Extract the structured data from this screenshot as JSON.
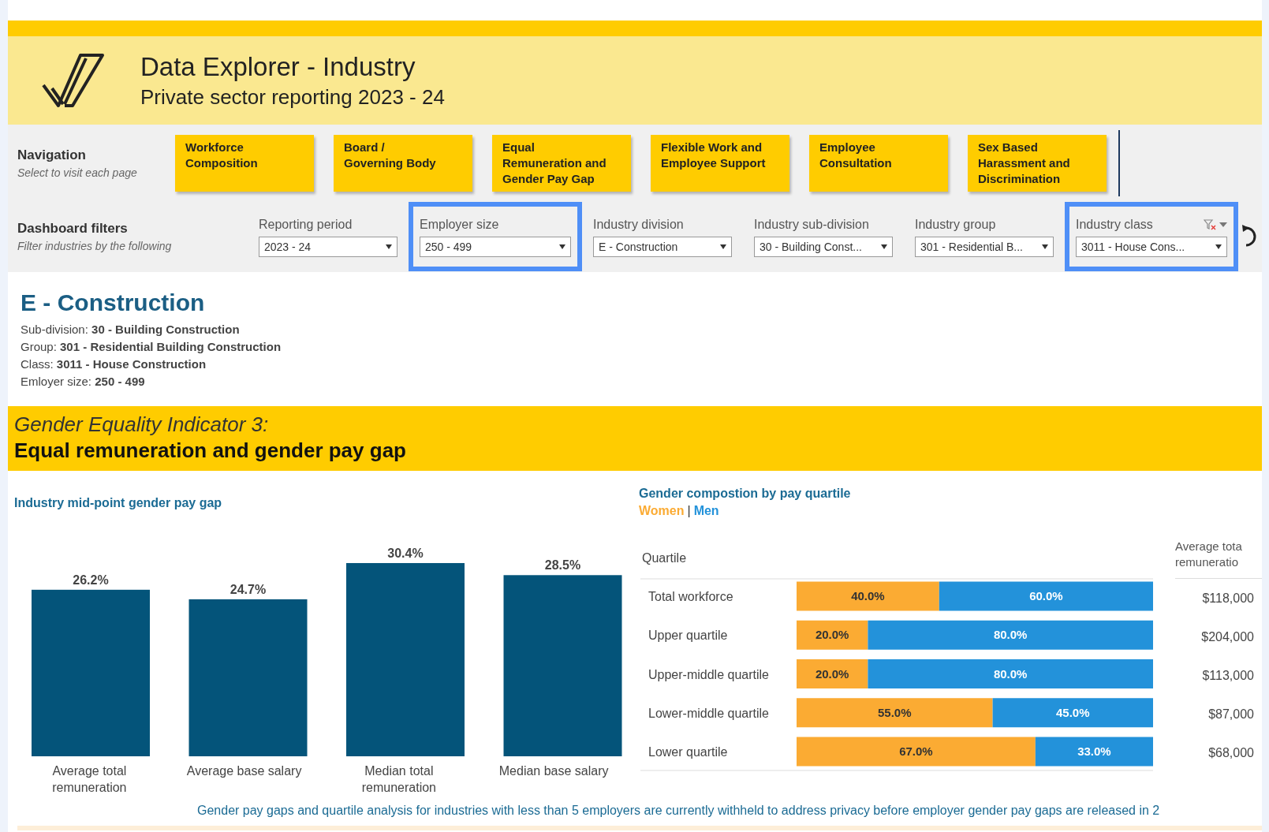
{
  "header": {
    "title": "Data Explorer - Industry",
    "subtitle": "Private sector reporting 2023 - 24"
  },
  "navigation": {
    "label": "Navigation",
    "hint": "Select to visit each page",
    "buttons": [
      "Workforce\nComposition",
      "Board /\nGoverning Body",
      "Equal\nRemuneration and\nGender Pay Gap",
      "Flexible Work and\nEmployee Support",
      "Employee\nConsultation",
      "Sex Based\nHarassment and\nDiscrimination"
    ]
  },
  "filters": {
    "label": "Dashboard filters",
    "hint": "Filter industries by the following",
    "items": [
      {
        "label": "Reporting period",
        "value": "2023 - 24",
        "highlighted": false,
        "clear_filter": false
      },
      {
        "label": "Employer size",
        "value": "250 - 499",
        "highlighted": true,
        "clear_filter": false
      },
      {
        "label": "Industry division",
        "value": "E - Construction",
        "highlighted": false,
        "clear_filter": false
      },
      {
        "label": "Industry sub-division",
        "value": "30 - Building Const...",
        "highlighted": false,
        "clear_filter": false
      },
      {
        "label": "Industry group",
        "value": "301 - Residential B...",
        "highlighted": false,
        "clear_filter": false
      },
      {
        "label": "Industry class",
        "value": "3011 - House Cons...",
        "highlighted": true,
        "clear_filter": true
      }
    ]
  },
  "industry": {
    "title": "E - Construction",
    "details": [
      "Sub-division: **30 - Building Construction**",
      "Group: **301 - Residential Building Construction**",
      "Class: **3011 - House Construction**",
      "Emloyer size: **250 - 499**"
    ]
  },
  "indicator": {
    "kicker": "Gender Equality Indicator 3:",
    "title": "Equal remuneration and gender pay gap"
  },
  "pay_gap": {
    "title": "Industry mid-point gender pay gap",
    "chart_data": {
      "type": "bar",
      "categories": [
        "Average total remuneration",
        "Average base salary",
        "Median total remuneration",
        "Median base salary"
      ],
      "values": [
        26.2,
        24.7,
        30.4,
        28.5
      ],
      "value_labels": [
        "26.2%",
        "24.7%",
        "30.4%",
        "28.5%"
      ]
    }
  },
  "quartiles": {
    "title": "Gender compostion by pay quartile",
    "legend_separator": "|",
    "row_header": "Quartile",
    "remuneration_header": "Average tota\nremuneratio",
    "chart_data": {
      "type": "bar",
      "orientation": "horizontal",
      "stacked": true,
      "categories": [
        "Total workforce",
        "Upper quartile",
        "Upper-middle quartile",
        "Lower-middle quartile",
        "Lower quartile"
      ],
      "series": [
        {
          "name": "Women",
          "color": "#fbab33",
          "values": [
            40,
            20,
            20,
            55,
            67
          ],
          "value_labels": [
            "40.0%",
            "20.0%",
            "20.0%",
            "55.0%",
            "67.0%"
          ]
        },
        {
          "name": "Men",
          "color": "#2392da",
          "values": [
            60,
            80,
            80,
            45,
            33
          ],
          "value_labels": [
            "60.0%",
            "80.0%",
            "80.0%",
            "45.0%",
            "33.0%"
          ]
        }
      ]
    },
    "remuneration": [
      "$118,000",
      "$204,000",
      "$113,000",
      "$87,000",
      "$68,000"
    ]
  },
  "footnote": "Gender pay gaps and quartile analysis for industries with less than 5 employers are currently withheld to address privacy before employer gender pay gaps are released in 2"
}
